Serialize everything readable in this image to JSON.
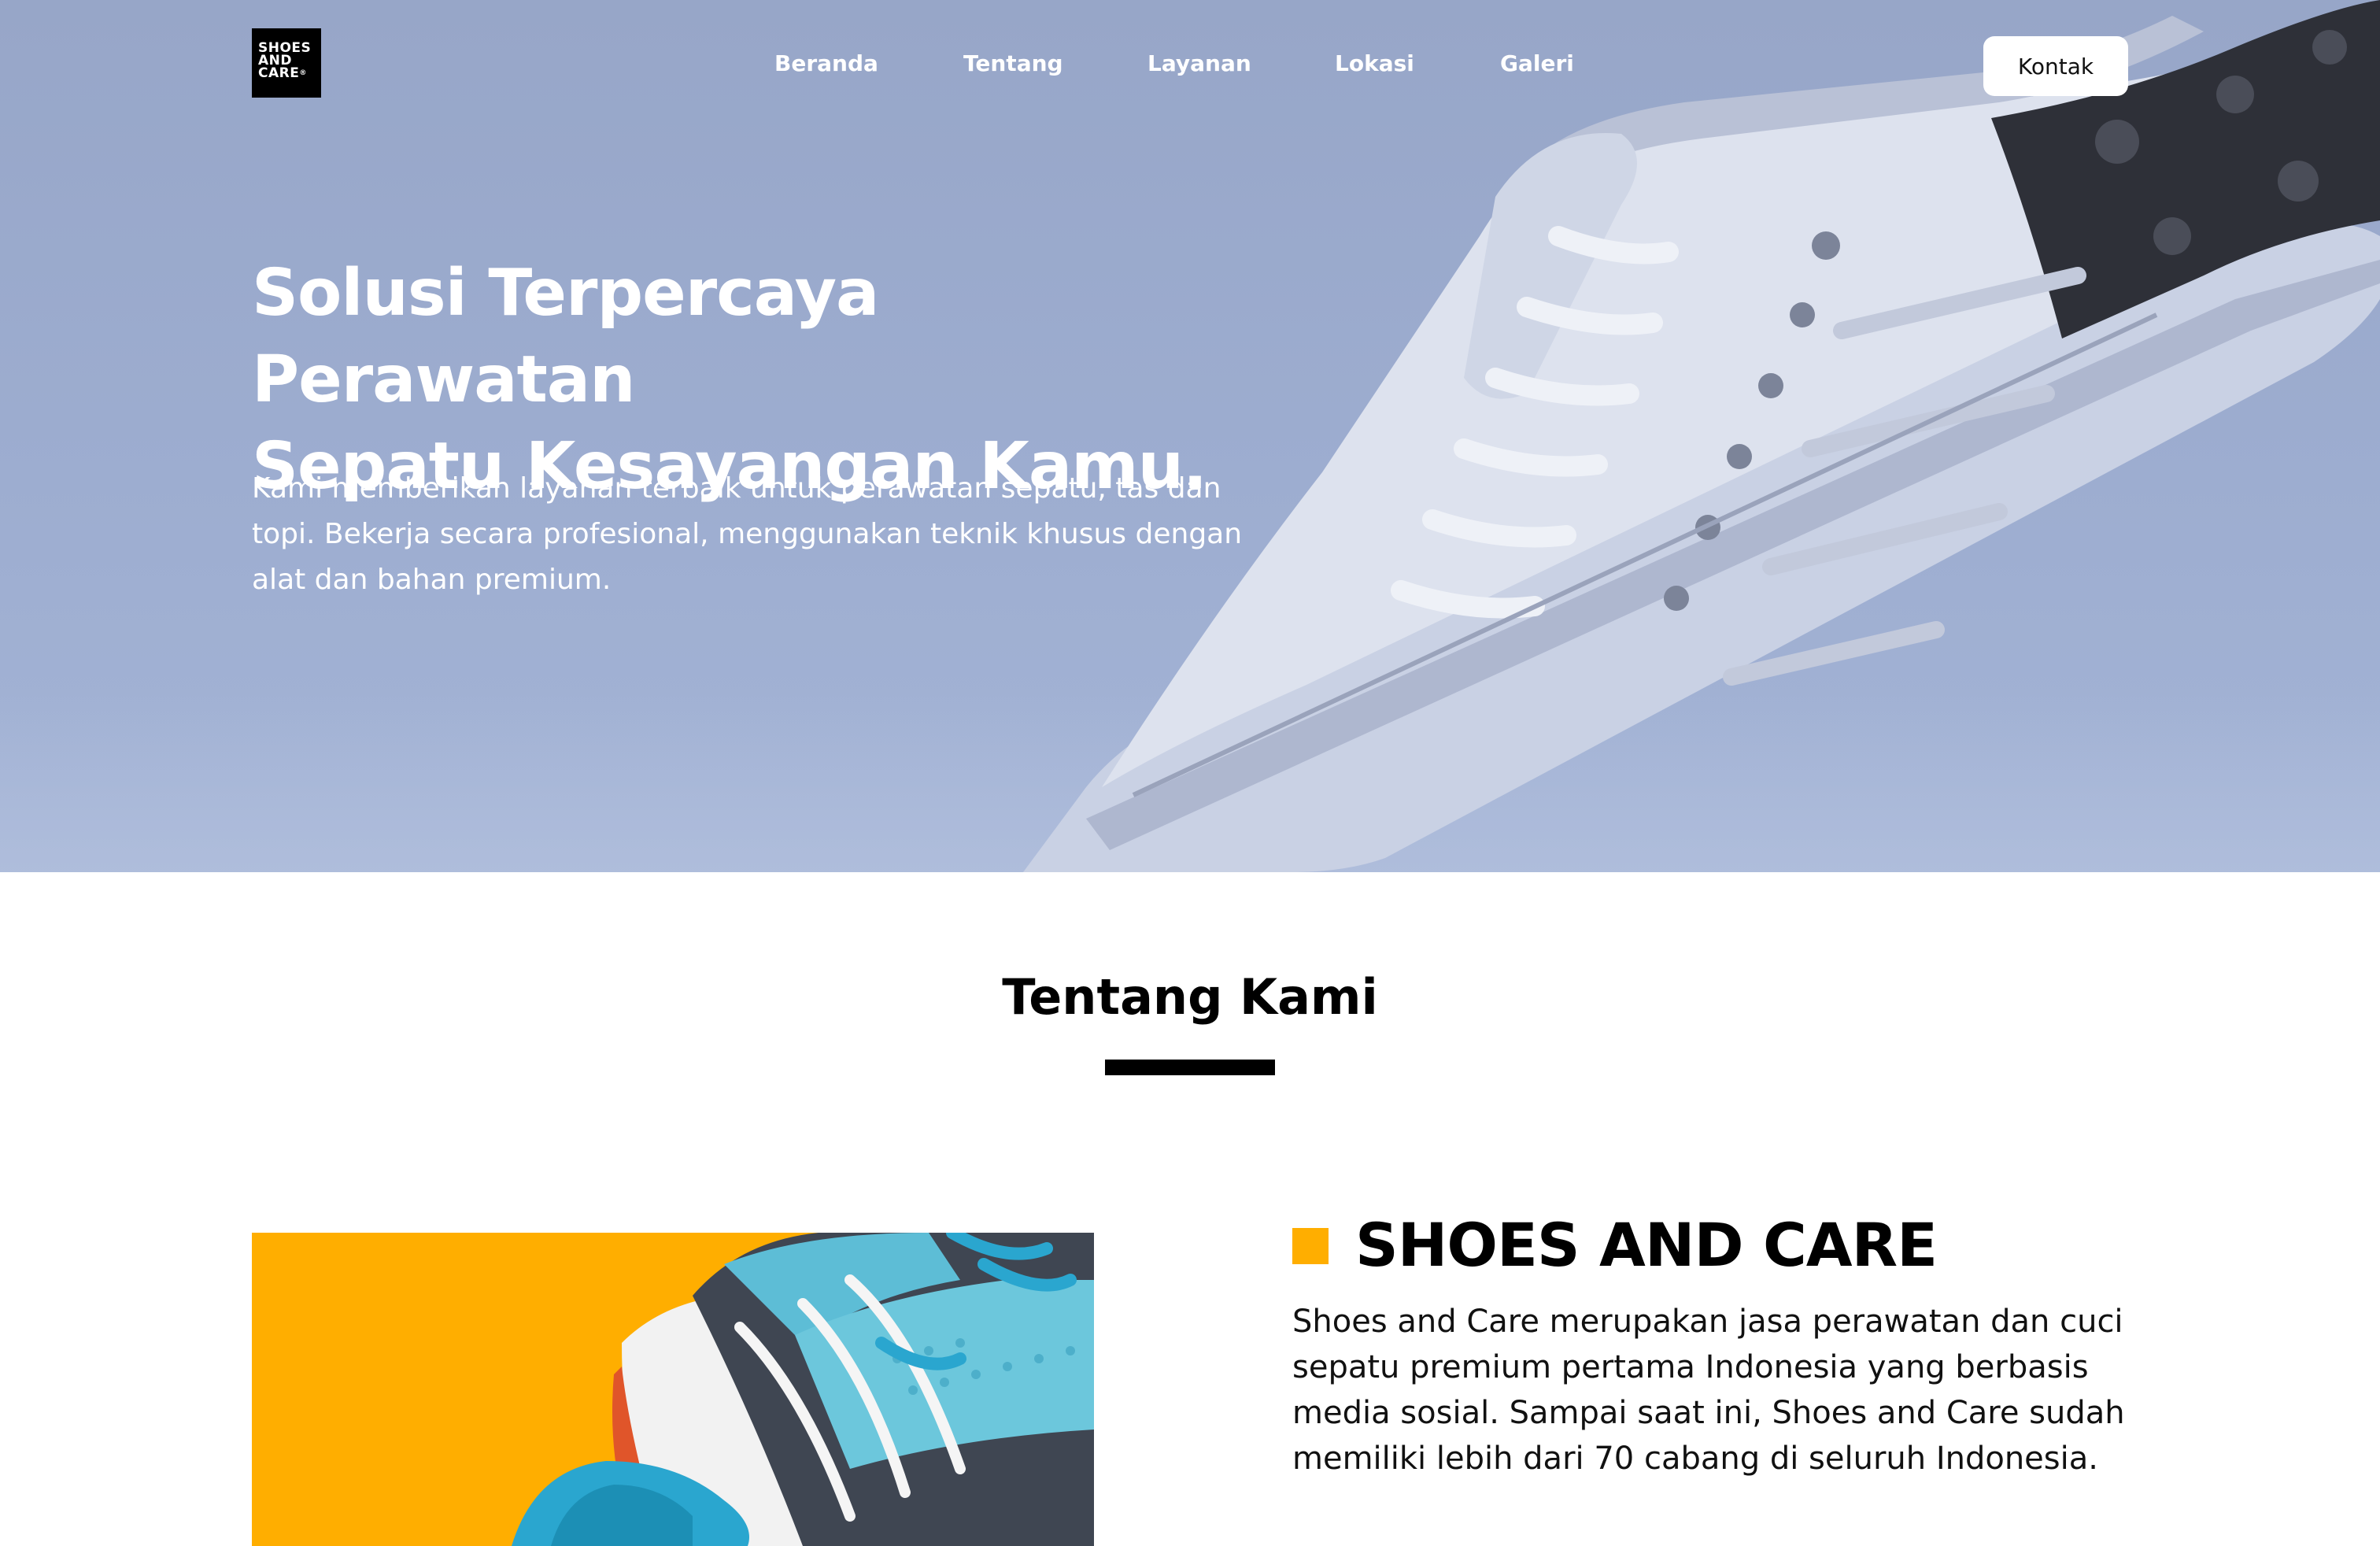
{
  "brand": {
    "logo_lines": [
      "SHOES",
      "AND",
      "CARE"
    ],
    "logo_mark": "®"
  },
  "nav": {
    "items": [
      {
        "label": "Beranda"
      },
      {
        "label": "Tentang"
      },
      {
        "label": "Layanan"
      },
      {
        "label": "Lokasi"
      },
      {
        "label": "Galeri"
      }
    ],
    "contact_label": "Kontak"
  },
  "hero": {
    "title_line1": "Solusi Terpercaya Perawatan",
    "title_line2": "Sepatu Kesayangan Kamu.",
    "description_line1": "Kami memberikan layanan terbaik untuk perawatan sepatu, tas dan",
    "description_line2": "topi. Bekerja secara profesional, menggunakan teknik khusus dengan",
    "description_line3": "alat dan bahan premium."
  },
  "about": {
    "section_title": "Tentang Kami",
    "heading": "SHOES AND CARE",
    "text_line1": "Shoes and Care merupakan jasa perawatan dan cuci",
    "text_line2": "sepatu premium pertama Indonesia yang berbasis",
    "text_line3": "media sosial. Sampai saat ini, Shoes and Care sudah",
    "text_line4": "memiliki lebih dari 70 cabang di seluruh Indonesia."
  },
  "colors": {
    "hero_bg": "#9dadd0",
    "accent": "#ffae00",
    "text_dark": "#000000",
    "text_light": "#ffffff"
  }
}
